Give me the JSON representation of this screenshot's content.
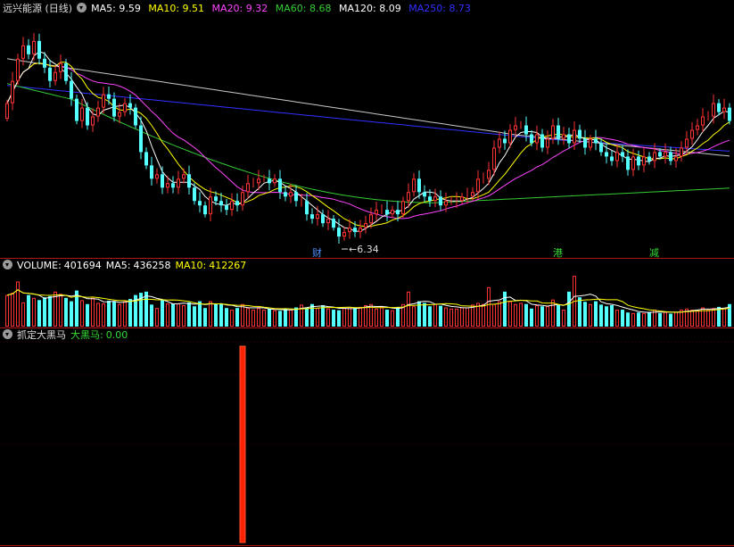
{
  "colors": {
    "background": "#000000",
    "up": "#ff3333",
    "down": "#54ffff",
    "panel_border": "#b01515",
    "ma5": "#ffffff",
    "ma10": "#ffff00",
    "ma20": "#ff44ff",
    "ma60": "#33cc33",
    "ma120": "#c8c8c8",
    "ma250": "#3030ff",
    "signal": "#ff2200"
  },
  "main_panel": {
    "title": "远兴能源 (日线)",
    "legend": [
      {
        "label": "MA5:",
        "value": "9.59",
        "color": "#ffffff"
      },
      {
        "label": "MA10:",
        "value": "9.51",
        "color": "#ffff00"
      },
      {
        "label": "MA20:",
        "value": "9.32",
        "color": "#ff44ff"
      },
      {
        "label": "MA60:",
        "value": "8.68",
        "color": "#33cc33"
      },
      {
        "label": "MA120:",
        "value": "8.09",
        "color": "#ffffff"
      },
      {
        "label": "MA250:",
        "value": "8.73",
        "color": "#3030ff"
      }
    ],
    "low_label": "6.34",
    "event_markers": [
      {
        "text": "财",
        "index": 58,
        "color": "#4f8fff"
      },
      {
        "text": "港",
        "index": 103,
        "color": "#33dd33"
      },
      {
        "text": "减",
        "index": 121,
        "color": "#33dd33"
      }
    ]
  },
  "volume_panel": {
    "title": "VOLUME:",
    "volume": "401694",
    "ma5_label": "MA5:",
    "ma5_value": "436258",
    "ma10_label": "MA10:",
    "ma10_value": "412267"
  },
  "indicator_panel": {
    "title": "抓定大黑马",
    "series_label": "大黑马:",
    "series_value": "0.00"
  },
  "chart_data": [
    {
      "type": "candlestick",
      "title": "远兴能源 (日线)",
      "n": 136,
      "price_range": [
        6.1,
        11.5
      ],
      "min_price": 6.34,
      "min_index": 62,
      "closes": [
        9.5,
        10.0,
        10.5,
        10.8,
        10.6,
        10.9,
        10.5,
        10.3,
        10.0,
        10.2,
        10.4,
        10.0,
        9.6,
        9.1,
        9.4,
        9.0,
        9.2,
        9.4,
        9.7,
        9.6,
        9.2,
        9.3,
        9.5,
        9.4,
        9.0,
        8.4,
        8.1,
        7.8,
        7.9,
        7.6,
        7.7,
        7.6,
        7.8,
        7.9,
        7.6,
        7.3,
        7.2,
        7.0,
        7.4,
        7.3,
        7.2,
        7.1,
        7.3,
        7.2,
        7.5,
        7.7,
        7.7,
        7.8,
        7.8,
        7.7,
        7.8,
        7.5,
        7.4,
        7.5,
        7.3,
        7.3,
        7.0,
        6.9,
        7.0,
        6.8,
        6.9,
        6.7,
        6.5,
        6.6,
        6.7,
        6.6,
        6.7,
        6.8,
        7.0,
        7.1,
        7.1,
        7.0,
        7.1,
        7.0,
        7.3,
        7.5,
        7.8,
        7.5,
        7.4,
        7.3,
        7.4,
        7.2,
        7.3,
        7.3,
        7.3,
        7.4,
        7.4,
        7.5,
        7.8,
        7.8,
        8.0,
        8.5,
        8.7,
        8.6,
        8.9,
        9.0,
        9.0,
        8.8,
        8.6,
        8.8,
        8.5,
        8.7,
        9.0,
        8.7,
        8.8,
        8.6,
        8.9,
        8.7,
        8.5,
        8.7,
        8.6,
        8.4,
        8.3,
        8.2,
        8.4,
        8.3,
        8.0,
        8.3,
        8.1,
        8.3,
        8.2,
        8.4,
        8.3,
        8.4,
        8.2,
        8.3,
        8.5,
        8.7,
        8.9,
        9.0,
        9.2,
        9.2,
        9.5,
        9.3,
        9.4,
        9.1
      ]
    },
    {
      "type": "bar",
      "title": "VOLUME",
      "volume_current": 401694,
      "ma5": 436258,
      "ma10": 412267,
      "volume_values": [
        560000,
        600000,
        800000,
        430000,
        560000,
        510000,
        470000,
        520000,
        540000,
        620000,
        580000,
        510000,
        450000,
        640000,
        470000,
        400000,
        510000,
        420000,
        410000,
        460000,
        450000,
        400000,
        450000,
        490000,
        560000,
        600000,
        620000,
        390000,
        330000,
        470000,
        410000,
        410000,
        410000,
        380000,
        430000,
        360000,
        450000,
        330000,
        450000,
        410000,
        400000,
        330000,
        300000,
        330000,
        400000,
        330000,
        300000,
        330000,
        300000,
        310000,
        290000,
        280000,
        310000,
        300000,
        340000,
        390000,
        340000,
        400000,
        330000,
        380000,
        320000,
        300000,
        290000,
        330000,
        350000,
        330000,
        350000,
        380000,
        400000,
        320000,
        340000,
        300000,
        290000,
        350000,
        400000,
        620000,
        360000,
        450000,
        420000,
        360000,
        400000,
        370000,
        340000,
        320000,
        320000,
        340000,
        340000,
        390000,
        420000,
        400000,
        700000,
        400000,
        450000,
        620000,
        450000,
        400000,
        420000,
        400000,
        320000,
        380000,
        360000,
        360000,
        480000,
        380000,
        300000,
        620000,
        900000,
        520000,
        440000,
        400000,
        450000,
        390000,
        360000,
        380000,
        300000,
        300000,
        250000,
        240000,
        250000,
        240000,
        260000,
        300000,
        240000,
        260000,
        230000,
        260000,
        300000,
        320000,
        300000,
        290000,
        340000,
        300000,
        330000,
        350000,
        330000,
        400000
      ]
    },
    {
      "type": "bar",
      "title": "抓定大黑马",
      "series_name": "大黑马",
      "current_value": 0,
      "spike_index": 44,
      "spike_value": 1
    }
  ]
}
